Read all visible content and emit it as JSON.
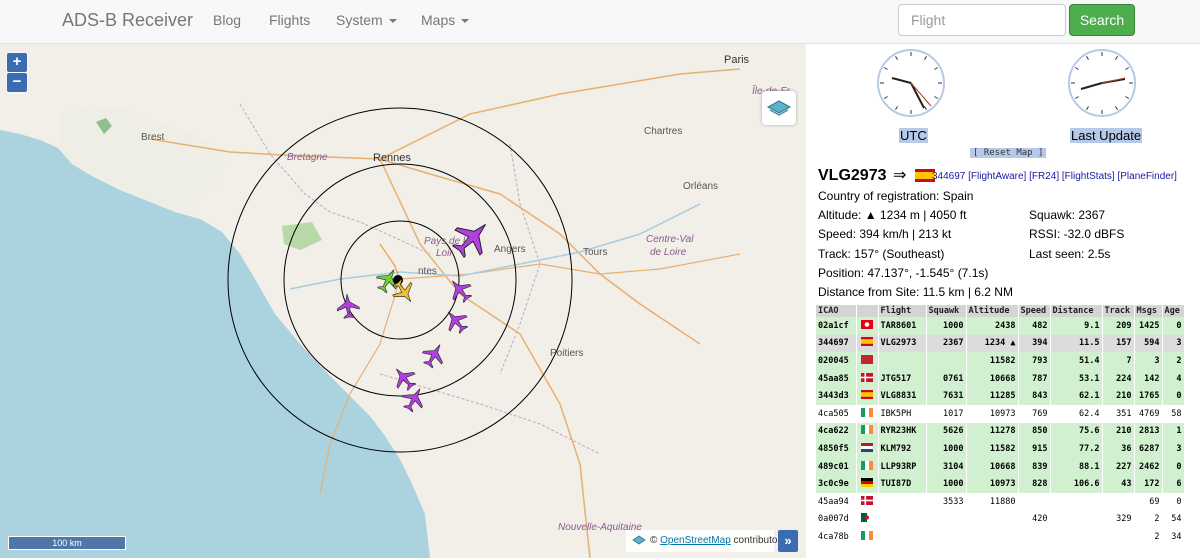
{
  "navbar": {
    "brand": "ADS-B Receiver",
    "items": [
      {
        "label": "Blog"
      },
      {
        "label": "Flights"
      },
      {
        "label": "System"
      },
      {
        "label": "Maps"
      }
    ],
    "search_placeholder": "Flight",
    "search_button": "Search"
  },
  "map": {
    "zoom_in": "+",
    "zoom_out": "−",
    "scale_label": "100 km",
    "attribution_prefix": "©",
    "attribution_link": "OpenStreetMap",
    "attribution_suffix": "contributors.",
    "expand_label": "»",
    "labels": {
      "paris": "Paris",
      "ile_de_france": "Île-de-Fr",
      "brest": "Brest",
      "chartres": "Chartres",
      "rennes": "Rennes",
      "bretagne": "Bretagne",
      "orleans": "Orléans",
      "pays_de_la_loire": "Pays de la",
      "loire": "Loir",
      "angers": "Angers",
      "centre": "Centre-Val",
      "de_loire": "de Loire",
      "tours": "Tours",
      "nantes": "ntes",
      "poitiers": "Poitiers",
      "nouvelle": "Nouvelle-Aquitaine"
    }
  },
  "sidebar": {
    "utc_label": "UTC",
    "last_update_label": "Last Update",
    "reset_map": "[ Reset Map ]",
    "selected": {
      "callsign": "VLG2973",
      "arrow": "⇒",
      "links": "344697 [FlightAware] [FR24] [FlightStats] [PlaneFinder]",
      "country": "Country of registration: Spain",
      "altitude": "Altitude: ▲ 1234 m | 4050 ft",
      "squawk": "Squawk: 2367",
      "speed": "Speed: 394 km/h | 213 kt",
      "rssi": "RSSI: -32.0 dBFS",
      "track": "Track: 157° (Southeast)",
      "last_seen": "Last seen: 2.5s",
      "position": "Position: 47.137°, -1.545° (7.1s)",
      "distance": "Distance from Site: 11.5 km | 6.2 NM"
    },
    "table": {
      "headers": [
        "ICAO",
        "",
        "Flight",
        "Squawk",
        "Altitude",
        "Speed",
        "Distance",
        "Track",
        "Msgs",
        "Age"
      ],
      "rows": [
        {
          "style": "vis",
          "flag": "tn",
          "cells": [
            "02a1cf",
            "",
            "TAR8601",
            "1000",
            "2438",
            "482",
            "9.1",
            "209",
            "1425",
            "0"
          ]
        },
        {
          "style": "sel",
          "flag": "es",
          "cells": [
            "344697",
            "",
            "VLG2973",
            "2367",
            "1234 ▲",
            "394",
            "11.5",
            "157",
            "594",
            "3"
          ]
        },
        {
          "style": "vis",
          "flag": "ma",
          "cells": [
            "020045",
            "",
            "",
            "",
            "11582",
            "793",
            "51.4",
            "7",
            "3",
            "2"
          ]
        },
        {
          "style": "vis",
          "flag": "dk",
          "cells": [
            "45aa85",
            "",
            "JTG517",
            "0761",
            "10668",
            "787",
            "53.1",
            "224",
            "142",
            "4"
          ]
        },
        {
          "style": "vis",
          "flag": "es",
          "cells": [
            "3443d3",
            "",
            "VLG8831",
            "7631",
            "11285",
            "843",
            "62.1",
            "210",
            "1765",
            "0"
          ]
        },
        {
          "style": "plain",
          "flag": "ie",
          "cells": [
            "4ca505",
            "",
            "IBK5PH",
            "1017",
            "10973",
            "769",
            "62.4",
            "351",
            "4769",
            "58"
          ]
        },
        {
          "style": "vis",
          "flag": "ie",
          "cells": [
            "4ca622",
            "",
            "RYR23HK",
            "5626",
            "11278",
            "850",
            "75.6",
            "210",
            "2813",
            "1"
          ]
        },
        {
          "style": "vis",
          "flag": "nl",
          "cells": [
            "4850f5",
            "",
            "KLM792",
            "1000",
            "11582",
            "915",
            "77.2",
            "36",
            "6287",
            "3"
          ]
        },
        {
          "style": "vis",
          "flag": "ie",
          "cells": [
            "489c01",
            "",
            "LLP93RP",
            "3104",
            "10668",
            "839",
            "88.1",
            "227",
            "2462",
            "0"
          ]
        },
        {
          "style": "vis",
          "flag": "de",
          "cells": [
            "3c0c9e",
            "",
            "TUI87D",
            "1000",
            "10973",
            "828",
            "106.6",
            "43",
            "172",
            "6"
          ]
        },
        {
          "style": "plain",
          "flag": "dk",
          "cells": [
            "45aa94",
            "",
            "",
            "3533",
            "11880",
            "",
            "",
            "",
            "69",
            "0"
          ]
        },
        {
          "style": "plain",
          "flag": "dz",
          "cells": [
            "0a007d",
            "",
            "",
            "",
            "",
            "420",
            "",
            "329",
            "2",
            "54"
          ]
        },
        {
          "style": "plain",
          "flag": "ie",
          "cells": [
            "4ca78b",
            "",
            "",
            "",
            "",
            "",
            "",
            "",
            "2",
            "34"
          ]
        }
      ]
    }
  },
  "colors": {
    "sea": "#aad3df",
    "land": "#f2efe9",
    "search_green": "#4cae4c",
    "visible_row": "#d0f0d0",
    "selected_row": "#dcdcdc",
    "aircraft_high": "#b040e0",
    "aircraft_low": "#70d040",
    "aircraft_selected": "#f0c030"
  }
}
